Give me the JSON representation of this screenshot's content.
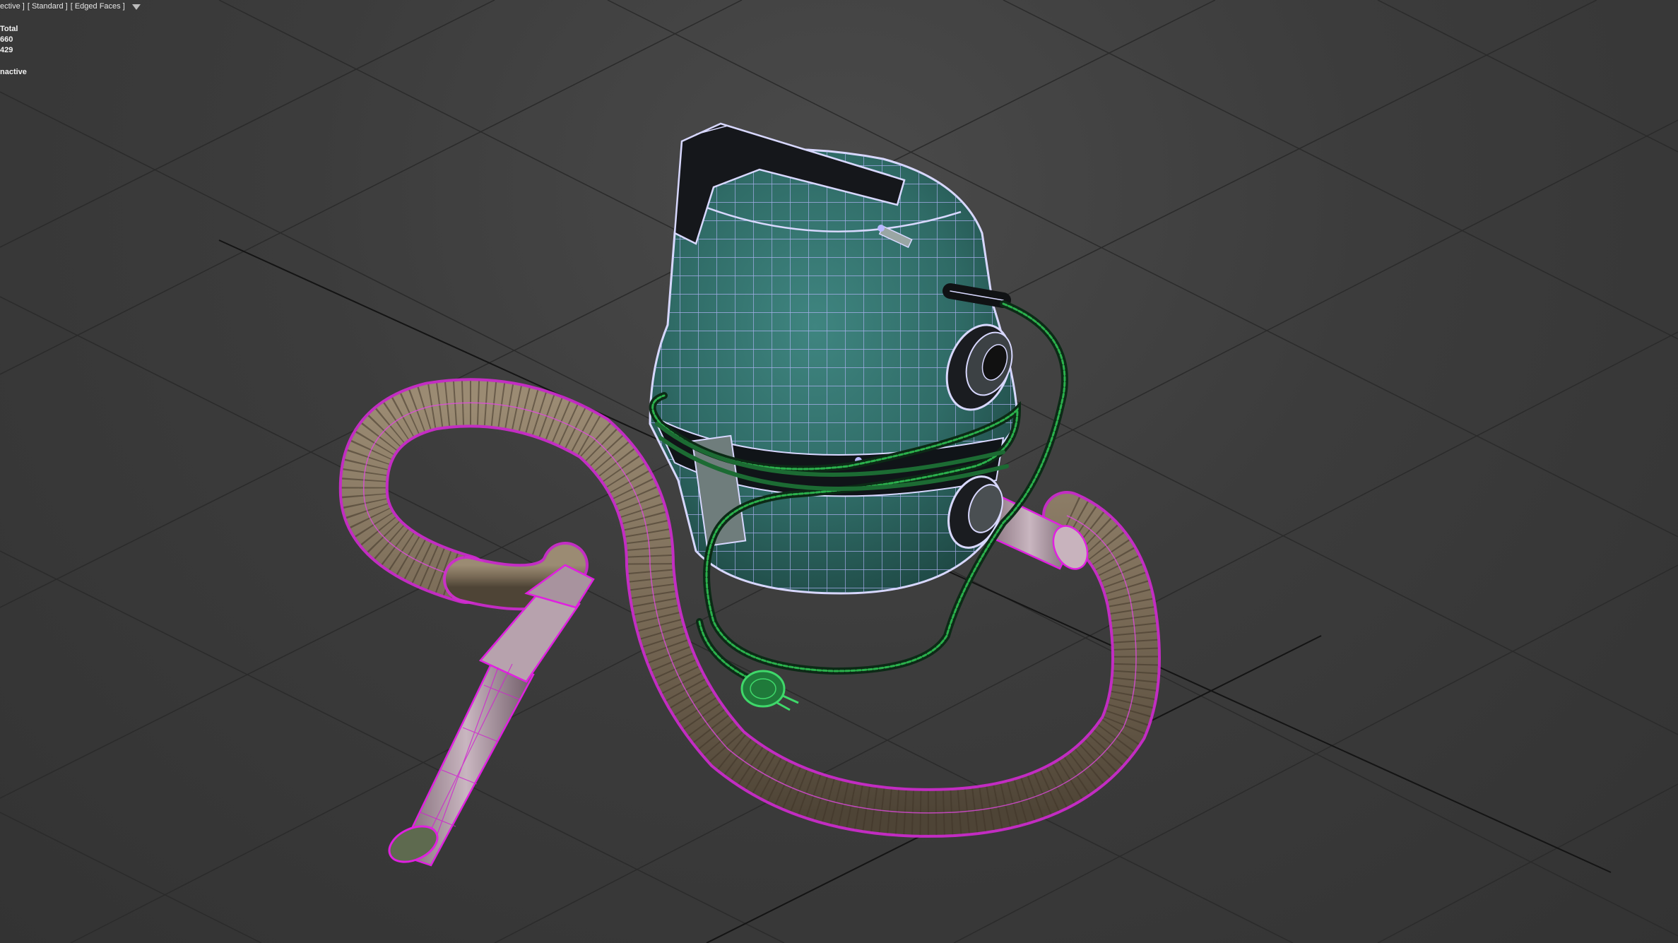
{
  "viewport": {
    "labels": [
      "ective ]",
      "[ Standard ]",
      "[ Edged Faces ]"
    ],
    "filter_icon": "filter-funnel-icon"
  },
  "stats": {
    "header": "Total",
    "line1": "660",
    "line2": "429",
    "status": "nactive"
  },
  "colors": {
    "background": "#3a3a3a",
    "grid": "#2a2a2a",
    "body_teal": "#2f6b66",
    "wire_body": "#b8b8ff",
    "hose": "#7a6a58",
    "wire_hose": "#e020e0",
    "cable": "#1f8a3a"
  }
}
